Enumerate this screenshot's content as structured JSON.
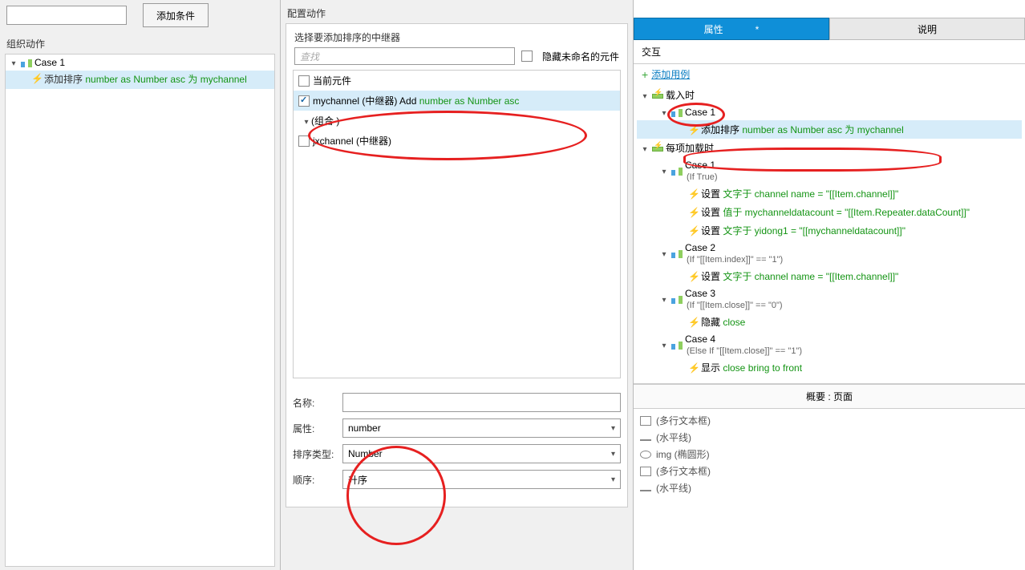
{
  "left": {
    "add_condition_btn": "添加条件",
    "org_actions_label": "组织动作",
    "case_label": "Case 1",
    "action_prefix": "添加排序 ",
    "action_green": "number as Number asc 为 mychannel"
  },
  "middle": {
    "config_label": "配置动作",
    "choose_repeater": "选择要添加排序的中继器",
    "search_placeholder": "查找",
    "hide_unnamed": "隐藏未命名的元件",
    "current_widget": "当前元件",
    "mychannel_label": "mychannel (中继器) Add ",
    "mychannel_green": "number as Number asc",
    "group_label": "(组合 )",
    "jxchannel": "jxchannel (中继器)",
    "form": {
      "name_label": "名称:",
      "name_value": "",
      "attr_label": "属性:",
      "attr_value": "number",
      "sort_type_label": "排序类型:",
      "sort_type_value": "Number",
      "order_label": "顺序:",
      "order_value": "升序"
    }
  },
  "right": {
    "tab_props": "属性",
    "tab_desc": "说明",
    "interaction_label": "交互",
    "add_case": "添加用例",
    "onload": "载入时",
    "onload_case": "Case 1",
    "onload_action_prefix": "添加排序 ",
    "onload_action_green": "number as Number asc 为 mychannel",
    "each_load": "每项加载时",
    "case1": "Case 1",
    "case1_cond": "(If True)",
    "a1_prefix": "设置 ",
    "a1_green": "文字于 channel name = \"[[Item.channel]]\"",
    "a2_prefix": "设置 ",
    "a2_green": "值于 mychanneldatacount = \"[[Item.Repeater.dataCount]]\"",
    "a3_prefix": "设置 ",
    "a3_green": "文字于 yidong1 = \"[[mychanneldatacount]]\"",
    "case2": "Case 2",
    "case2_cond": "(If \"[[Item.index]]\" == \"1\")",
    "b1_prefix": "设置 ",
    "b1_green": "文字于 channel name = \"[[Item.channel]]\"",
    "case3": "Case 3",
    "case3_cond": "(If \"[[Item.close]]\" == \"0\")",
    "c1_prefix": "隐藏 ",
    "c1_green": "close",
    "case4": "Case 4",
    "case4_cond": "(Else If \"[[Item.close]]\" == \"1\")",
    "d1_prefix": "显示 ",
    "d1_green": "close bring to front",
    "overview": "概要 : 页面",
    "ol1": "(多行文本框)",
    "ol2": "(水平线)",
    "ol3": "img (椭圆形)",
    "ol4": "(多行文本框)",
    "ol5": "(水平线)"
  }
}
